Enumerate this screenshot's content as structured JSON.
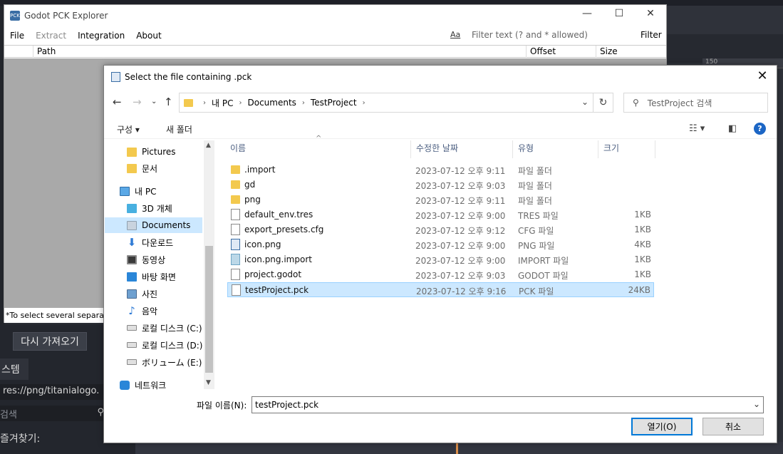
{
  "editor": {
    "reimport_button": "다시 가져오기",
    "filesystem_tab": "스템",
    "path_value": "res://png/titanialogo.",
    "search_placeholder": "검색",
    "favorites_label": "즐겨찾기:",
    "ruler_label": "150"
  },
  "pck_window": {
    "title": "Godot PCK Explorer",
    "menu": [
      "File",
      "Extract",
      "Integration",
      "About"
    ],
    "filter_match_case": "Aa",
    "filter_placeholder": "Filter text (? and * allowed)",
    "filter_button": "Filter",
    "columns": [
      "Path",
      "Offset",
      "Size"
    ],
    "hint_text": "*To select several separate"
  },
  "dialog": {
    "title": "Select the file containing .pck",
    "breadcrumb": [
      "내 PC",
      "Documents",
      "TestProject"
    ],
    "search_placeholder": "TestProject 검색",
    "organize_label": "구성",
    "new_folder_label": "새 폴더",
    "nav_items": [
      {
        "label": "Pictures",
        "icon": "folder-icon"
      },
      {
        "label": "문서",
        "icon": "folder-icon"
      },
      {
        "label": "내 PC",
        "icon": "computer-icon"
      },
      {
        "label": "3D 개체",
        "icon": "3d-objects-icon"
      },
      {
        "label": "Documents",
        "icon": "documents-icon"
      },
      {
        "label": "다운로드",
        "icon": "download-icon"
      },
      {
        "label": "동영상",
        "icon": "video-icon"
      },
      {
        "label": "바탕 화면",
        "icon": "desktop-icon"
      },
      {
        "label": "사진",
        "icon": "pictures-icon"
      },
      {
        "label": "음악",
        "icon": "music-icon"
      },
      {
        "label": "로컬 디스크 (C:)",
        "icon": "drive-icon"
      },
      {
        "label": "로컬 디스크 (D:)",
        "icon": "drive-icon"
      },
      {
        "label": "ボリューム (E:)",
        "icon": "drive-icon"
      },
      {
        "label": "네트워크",
        "icon": "network-icon"
      }
    ],
    "columns": {
      "name": "이름",
      "date": "수정한 날짜",
      "type": "유형",
      "size": "크기"
    },
    "files": [
      {
        "name": ".import",
        "date": "2023-07-12 오후 9:11",
        "type": "파일 폴더",
        "size": "",
        "icon": "folder"
      },
      {
        "name": "gd",
        "date": "2023-07-12 오후 9:03",
        "type": "파일 폴더",
        "size": "",
        "icon": "folder"
      },
      {
        "name": "png",
        "date": "2023-07-12 오후 9:11",
        "type": "파일 폴더",
        "size": "",
        "icon": "folder"
      },
      {
        "name": "default_env.tres",
        "date": "2023-07-12 오후 9:00",
        "type": "TRES 파일",
        "size": "1KB",
        "icon": "file"
      },
      {
        "name": "export_presets.cfg",
        "date": "2023-07-12 오후 9:12",
        "type": "CFG 파일",
        "size": "1KB",
        "icon": "file"
      },
      {
        "name": "icon.png",
        "date": "2023-07-12 오후 9:00",
        "type": "PNG 파일",
        "size": "4KB",
        "icon": "img"
      },
      {
        "name": "icon.png.import",
        "date": "2023-07-12 오후 9:00",
        "type": "IMPORT 파일",
        "size": "1KB",
        "icon": "imgimp"
      },
      {
        "name": "project.godot",
        "date": "2023-07-12 오후 9:03",
        "type": "GODOT 파일",
        "size": "1KB",
        "icon": "file"
      },
      {
        "name": "testProject.pck",
        "date": "2023-07-12 오후 9:16",
        "type": "PCK 파일",
        "size": "24KB",
        "icon": "file"
      }
    ],
    "filename_label": "파일 이름(N):",
    "filename_value": "testProject.pck",
    "open_button": "열기(O)",
    "cancel_button": "취소",
    "selected_color": "#cce8ff"
  }
}
